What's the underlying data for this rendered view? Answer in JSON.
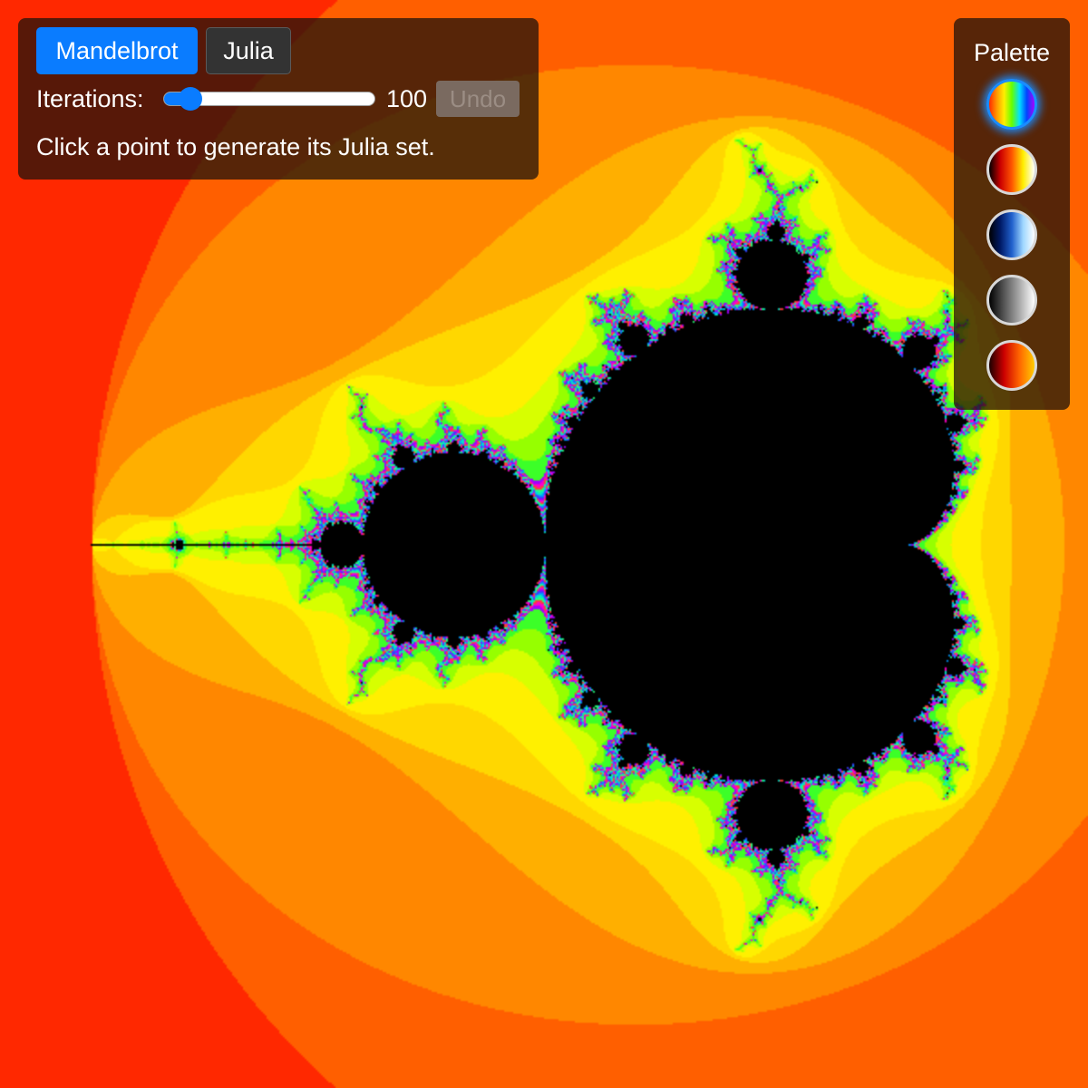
{
  "app": {
    "mode": "Mandelbrot",
    "selected_palette": "rainbow"
  },
  "controls": {
    "mandelbrot_label": "Mandelbrot",
    "julia_label": "Julia",
    "iterations_label": "Iterations:",
    "iterations_value": "100",
    "iterations_slider": {
      "value": 100,
      "min": 100,
      "max": 1000,
      "fraction": 0.1
    },
    "undo_label": "Undo",
    "undo_enabled": false,
    "hint": "Click a point to generate its Julia set."
  },
  "palette_panel": {
    "title": "Palette",
    "swatches": [
      {
        "name": "rainbow",
        "selected": true,
        "colors": [
          "#ff2a00",
          "#ff9900",
          "#ffee00",
          "#66ff00",
          "#00e0ff",
          "#0044ff",
          "#aa00ff"
        ]
      },
      {
        "name": "fire",
        "selected": false,
        "colors": [
          "#000000",
          "#cc0000",
          "#ff5500",
          "#ffee00",
          "#ffffff"
        ]
      },
      {
        "name": "ocean",
        "selected": false,
        "colors": [
          "#000000",
          "#001a66",
          "#2060cc",
          "#a0d8ff",
          "#ffffff"
        ]
      },
      {
        "name": "grayscale",
        "selected": false,
        "colors": [
          "#000000",
          "#555555",
          "#aaaaaa",
          "#ffffff"
        ]
      },
      {
        "name": "lava",
        "selected": false,
        "colors": [
          "#1a0000",
          "#cc0000",
          "#ff6600",
          "#ffcc00"
        ]
      }
    ]
  },
  "colors": {
    "accent": "#0a7cff",
    "panel_background": "rgba(40,20,10,0.78)",
    "set_interior": "#000000"
  },
  "fractal": {
    "type": "mandelbrot",
    "center_real": -0.75,
    "center_imag": 0,
    "span_real": 3.0
  }
}
